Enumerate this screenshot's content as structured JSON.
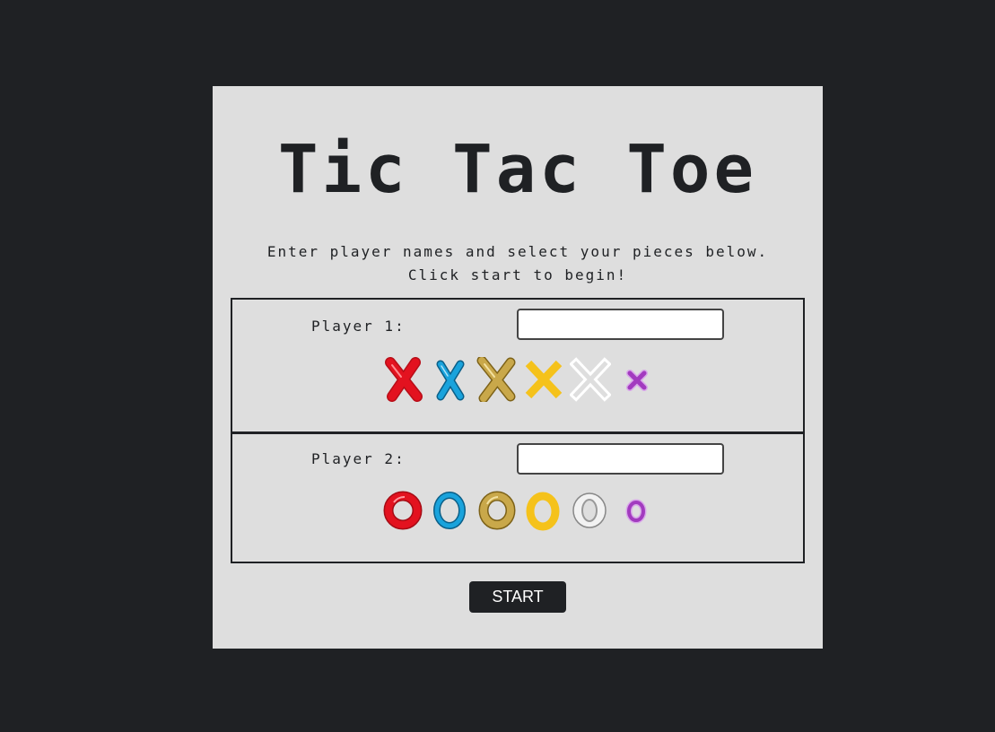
{
  "title": "Tic Tac Toe",
  "instructions": {
    "line1": "Enter player names and select your pieces below.",
    "line2": "Click start to begin!"
  },
  "player1": {
    "label": "Player 1:",
    "name_value": "",
    "pieces": [
      {
        "icon": "red-x-icon",
        "color": "#e3121f"
      },
      {
        "icon": "blue-x-icon",
        "color": "#1aa3dc"
      },
      {
        "icon": "gold-x-icon",
        "color": "#b8942e"
      },
      {
        "icon": "yellow-x-icon",
        "color": "#f5c21b"
      },
      {
        "icon": "white-x-icon",
        "color": "#ffffff"
      },
      {
        "icon": "purple-x-icon",
        "color": "#a23bbf"
      }
    ]
  },
  "player2": {
    "label": "Player 2:",
    "name_value": "",
    "pieces": [
      {
        "icon": "red-o-icon",
        "color": "#e3121f"
      },
      {
        "icon": "blue-o-icon",
        "color": "#1aa3dc"
      },
      {
        "icon": "gold-o-icon",
        "color": "#b8942e"
      },
      {
        "icon": "yellow-o-icon",
        "color": "#f5c21b"
      },
      {
        "icon": "white-o-icon",
        "color": "#f2f2f2"
      },
      {
        "icon": "purple-o-icon",
        "color": "#a23bbf"
      }
    ]
  },
  "start_label": "START",
  "colors": {
    "page_background": "#1f2124",
    "card_background": "#dedede",
    "text": "#1f2124"
  }
}
